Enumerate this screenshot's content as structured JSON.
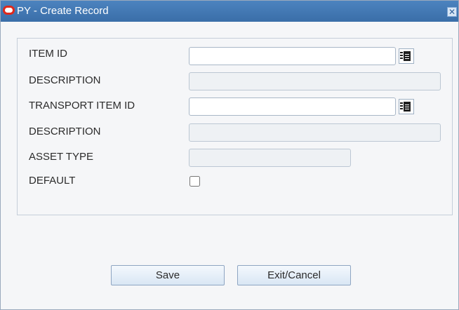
{
  "window": {
    "title": "PY - Create Record",
    "close_symbol": "✕",
    "logo_icon": "oracle-logo-icon",
    "accent_color": "#3a6ea8"
  },
  "form": {
    "item_id": {
      "label": "ITEM ID",
      "value": ""
    },
    "item_description": {
      "label": "DESCRIPTION",
      "value": ""
    },
    "transport_item_id": {
      "label": "TRANSPORT ITEM ID",
      "value": ""
    },
    "transport_description": {
      "label": "DESCRIPTION",
      "value": ""
    },
    "asset_type": {
      "label": "ASSET TYPE",
      "value": ""
    },
    "default": {
      "label": "DEFAULT",
      "checked": false
    }
  },
  "buttons": {
    "save": "Save",
    "exit_cancel": "Exit/Cancel"
  }
}
